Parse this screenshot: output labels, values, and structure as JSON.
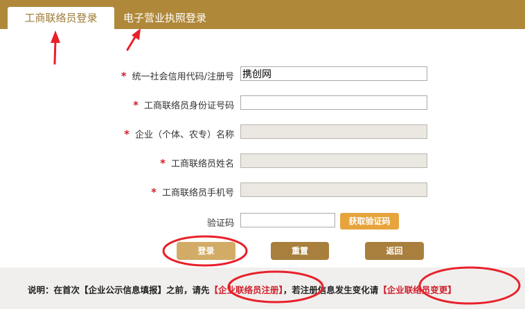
{
  "tabs": [
    {
      "label": "工商联络员登录",
      "active": true
    },
    {
      "label": "电子营业执照登录",
      "active": false
    }
  ],
  "form": {
    "fields": [
      {
        "label": "统一社会信用代码/注册号",
        "required": true,
        "value": "携创网",
        "disabled": false
      },
      {
        "label": "工商联络员身份证号码",
        "required": true,
        "value": "",
        "disabled": false
      },
      {
        "label": "企业（个体、农专）名称",
        "required": true,
        "value": "",
        "disabled": true
      },
      {
        "label": "工商联络员姓名",
        "required": true,
        "value": "",
        "disabled": true
      },
      {
        "label": "工商联络员手机号",
        "required": true,
        "value": "",
        "disabled": true
      }
    ],
    "captcha": {
      "label": "验证码",
      "value": "",
      "button": "获取验证码"
    },
    "required_mark": "*"
  },
  "buttons": {
    "login": "登录",
    "reset": "重置",
    "back": "返回"
  },
  "footer": {
    "prefix": "说明：在首次【企业公示信息填报】之前，请先",
    "link_register": "【企业联络员注册】",
    "middle": "，若注册信息发生变化请",
    "link_change": "【企业联络员变更】"
  },
  "colors": {
    "brand": "#b0883a",
    "annotation_red": "#e8202a",
    "required_red": "#d0202c"
  }
}
